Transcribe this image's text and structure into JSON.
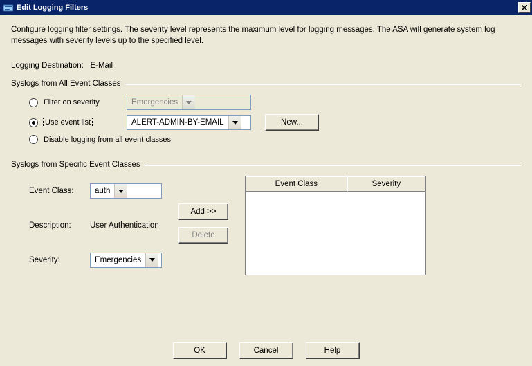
{
  "window": {
    "title": "Edit Logging Filters"
  },
  "description": "Configure logging filter settings. The severity level represents the maximum level for logging messages. The ASA will generate system log messages with severity levels up to the specified level.",
  "destination": {
    "label": "Logging Destination:",
    "value": "E-Mail"
  },
  "allEvents": {
    "heading": "Syslogs from All Event Classes",
    "filterOnSeverity": {
      "label": "Filter on severity",
      "selected": false,
      "dropdownValue": "Emergencies"
    },
    "useEventList": {
      "label": "Use event list",
      "selected": true,
      "dropdownValue": "ALERT-ADMIN-BY-EMAIL",
      "newButton": "New..."
    },
    "disableLogging": {
      "label": "Disable logging from all event classes",
      "selected": false
    }
  },
  "specificEvents": {
    "heading": "Syslogs from Specific Event Classes",
    "eventClass": {
      "label": "Event Class:",
      "value": "auth"
    },
    "description": {
      "label": "Description:",
      "value": "User Authentication"
    },
    "severity": {
      "label": "Severity:",
      "value": "Emergencies"
    },
    "addButton": "Add >>",
    "deleteButton": "Delete",
    "table": {
      "columns": [
        "Event Class",
        "Severity"
      ],
      "rows": []
    }
  },
  "footer": {
    "ok": "OK",
    "cancel": "Cancel",
    "help": "Help"
  }
}
